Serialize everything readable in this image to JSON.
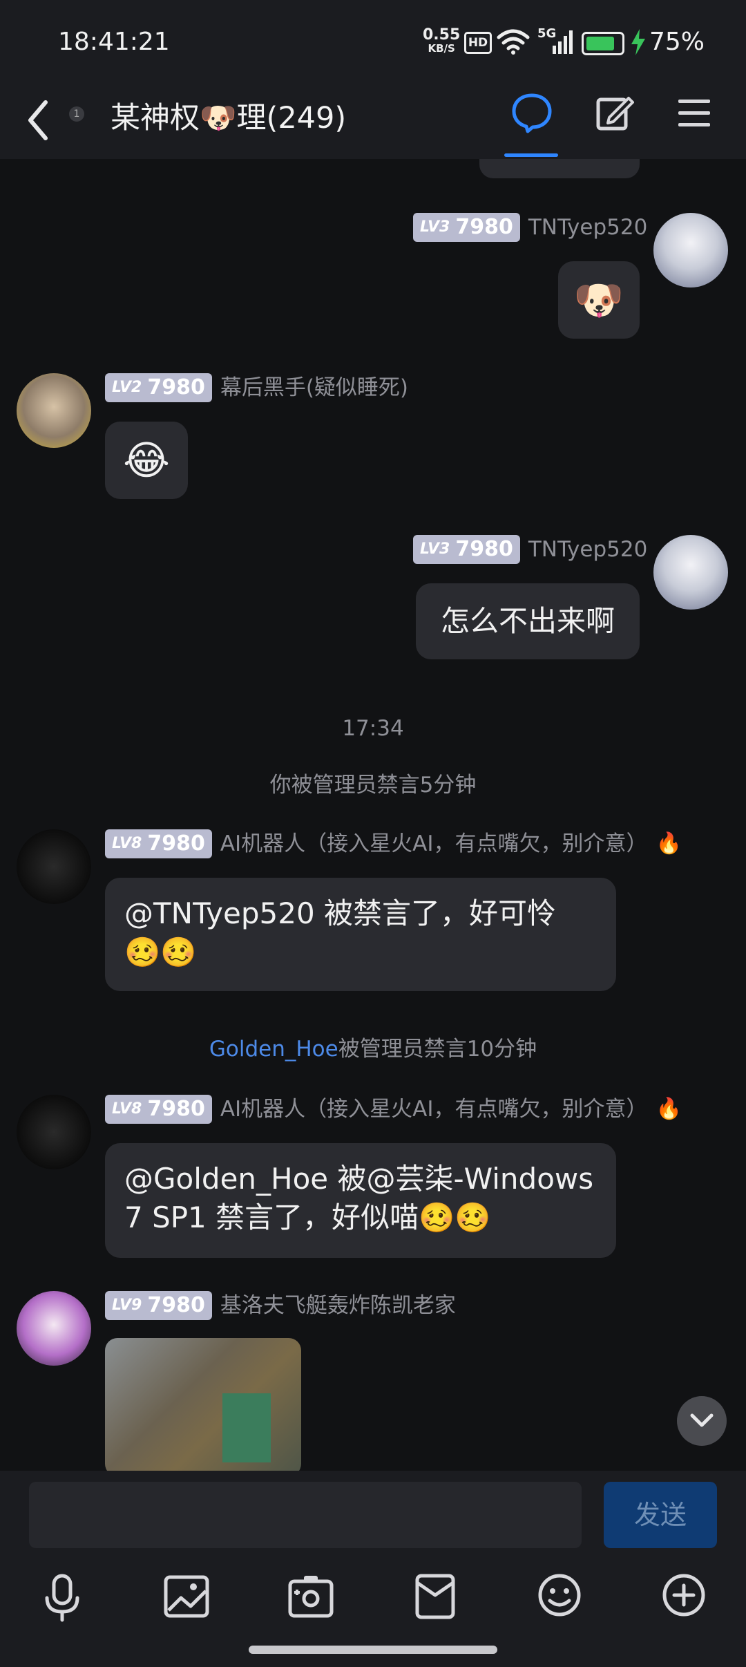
{
  "status": {
    "time": "18:41:21",
    "speed_value": "0.55",
    "speed_unit": "KB/S",
    "hd": "HD",
    "signal": "5G",
    "battery": "75%"
  },
  "header": {
    "title": "某神权🐶理(249)",
    "unread": "1"
  },
  "messages": {
    "m1": {
      "level": "LV3",
      "level_num": "7980",
      "name": "TNTyep520",
      "content": "🐶"
    },
    "m2": {
      "level": "LV2",
      "level_num": "7980",
      "name": "幕后黑手(疑似睡死)",
      "content": "😂"
    },
    "m3": {
      "level": "LV3",
      "level_num": "7980",
      "name": "TNTyep520",
      "content": "怎么不出来啊"
    },
    "timestamp": "17:34",
    "system1": "你被管理员禁言5分钟",
    "m4": {
      "level": "LV8",
      "level_num": "7980",
      "name": "AI机器人（接入星火AI，有点嘴欠，别介意）",
      "fire": "🔥",
      "content_line1": "@TNTyep520 被禁言了，好可怜",
      "content_line2": "🥴🥴"
    },
    "system2_user": "Golden_Hoe",
    "system2_text": "被管理员禁言10分钟",
    "m5": {
      "level": "LV8",
      "level_num": "7980",
      "name": "AI机器人（接入星火AI，有点嘴欠，别介意）",
      "fire": "🔥",
      "content_line1": "@Golden_Hoe 被@芸柒-Windows",
      "content_line2": "7 SP1 禁言了，好似喵🥴🥴"
    },
    "m6": {
      "level": "LV9",
      "level_num": "7980",
      "name": "基洛夫飞艇轰炸陈凯老家"
    }
  },
  "composer": {
    "send_label": "发送"
  },
  "colors": {
    "accent": "#2f86ff",
    "background": "#111214",
    "bubble": "#2a2b30",
    "send_bg": "#0f3b73"
  }
}
